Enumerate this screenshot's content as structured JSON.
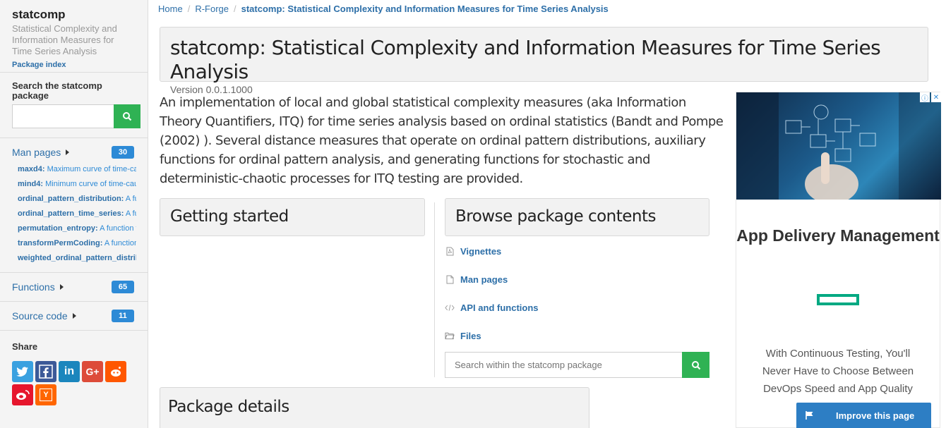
{
  "sidebar": {
    "title": "statcomp",
    "subtitle": "Statistical Complexity and Information Measures for Time Series Analysis",
    "index_link": "Package index",
    "search_label": "Search the statcomp package",
    "search_placeholder": "",
    "man_pages": {
      "title": "Man pages",
      "count": "30",
      "items": [
        {
          "name": "maxd4:",
          "desc": " Maximum curve of time-causal..."
        },
        {
          "name": "mind4:",
          "desc": " Minimum curve of time-causal..."
        },
        {
          "name": "ordinal_pattern_distribution:",
          "desc": " A function..."
        },
        {
          "name": "ordinal_pattern_time_series:",
          "desc": " A function..."
        },
        {
          "name": "permutation_entropy:",
          "desc": " A function to..."
        },
        {
          "name": "transformPermCoding:",
          "desc": " A function to..."
        },
        {
          "name": "weighted_ordinal_pattern_distribution:",
          "desc": ""
        }
      ]
    },
    "functions": {
      "title": "Functions",
      "count": "65"
    },
    "source_code": {
      "title": "Source code",
      "count": "11"
    },
    "share_title": "Share"
  },
  "breadcrumb": {
    "home": "Home",
    "forge": "R-Forge",
    "current": "statcomp: Statistical Complexity and Information Measures for Time Series Analysis"
  },
  "header": {
    "title": "statcomp: Statistical Complexity and Information Measures for Time Series Analysis",
    "version": "Version 0.0.1.1000"
  },
  "description": "An implementation of local and global statistical complexity measures (aka Information Theory Quantifiers, ITQ) for time series analysis based on ordinal statistics (Bandt and Pompe (2002) ). Several distance measures that operate on ordinal pattern distributions, auxiliary functions for ordinal pattern analysis, and generating functions for stochastic and deterministic-chaotic processes for ITQ testing are provided.",
  "getting_started": "Getting started",
  "browse": {
    "title": "Browse package contents",
    "items": [
      {
        "icon": "pdf-file-icon",
        "label": "Vignettes"
      },
      {
        "icon": "file-icon",
        "label": "Man pages"
      },
      {
        "icon": "code-icon",
        "label": "API and functions"
      },
      {
        "icon": "folder-icon",
        "label": "Files"
      }
    ],
    "search_placeholder": "Search within the statcomp package"
  },
  "package_details": "Package details",
  "ad": {
    "title": "App Delivery Management",
    "text": "With Continuous Testing, You'll Never Have to Choose Between DevOps Speed and App Quality"
  },
  "improve_label": "Improve this page",
  "colors": {
    "link": "#2d6fa8",
    "badge": "#2d8ad6",
    "search_button": "#2fb254",
    "improve_button": "#2d7ec4",
    "ad_logo": "#01a982"
  }
}
